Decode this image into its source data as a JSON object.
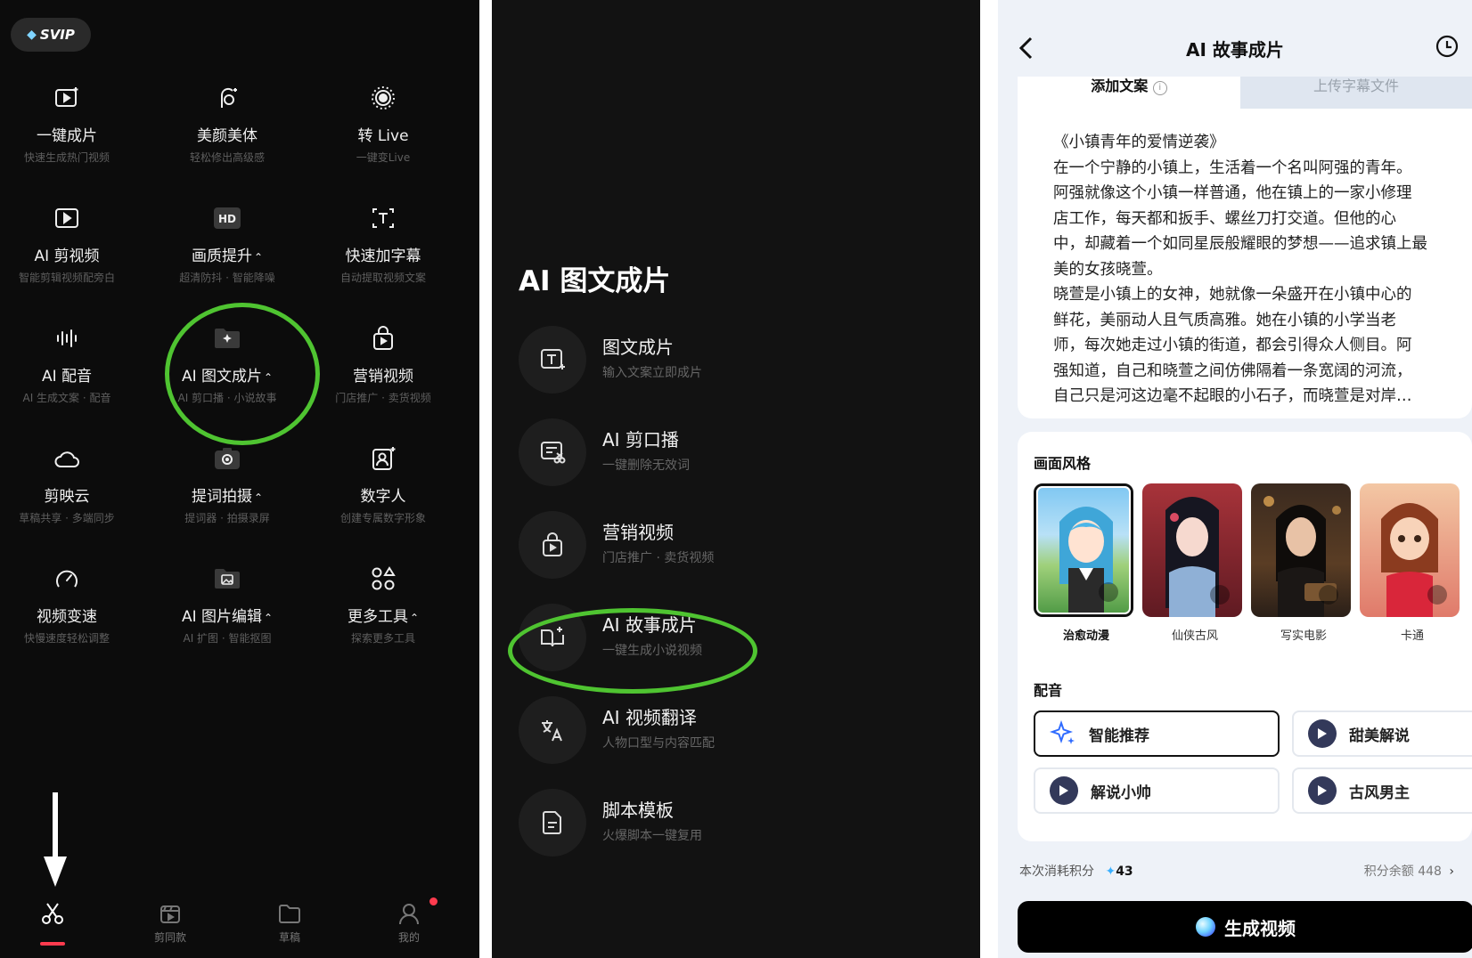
{
  "panel1": {
    "svip_label": "SVIP",
    "tools": [
      {
        "title": "一键成片",
        "sub": "快速生成热门视频",
        "icon": "play-sparkle-icon"
      },
      {
        "title": "美颜美体",
        "sub": "轻松修出高级感",
        "icon": "face-icon"
      },
      {
        "title": "转 Live",
        "sub": "一键变Live",
        "icon": "live-icon"
      },
      {
        "title": "AI 剪视频",
        "sub": "智能剪辑视频配旁白",
        "icon": "ai-video-icon"
      },
      {
        "title": "画质提升",
        "sub": "超清防抖 · 智能降噪",
        "icon": "hd-icon",
        "chevron": "⌃"
      },
      {
        "title": "快速加字幕",
        "sub": "自动提取视频文案",
        "icon": "subtitle-icon"
      },
      {
        "title": "AI 配音",
        "sub": "AI 生成文案 · 配音",
        "icon": "waveform-icon"
      },
      {
        "title": "AI 图文成片",
        "sub": "AI 剪口播 · 小说故事",
        "icon": "folder-sparkle-icon",
        "chevron": "⌃"
      },
      {
        "title": "营销视频",
        "sub": "门店推广 · 卖货视频",
        "icon": "shopping-bag-icon"
      },
      {
        "title": "剪映云",
        "sub": "草稿共享 · 多端同步",
        "icon": "cloud-icon"
      },
      {
        "title": "提词拍摄",
        "sub": "提词器 · 拍摄录屏",
        "icon": "camera-icon",
        "chevron": "⌃"
      },
      {
        "title": "数字人",
        "sub": "创建专属数字形象",
        "icon": "digital-human-icon"
      },
      {
        "title": "视频变速",
        "sub": "快慢速度轻松调整",
        "icon": "speed-icon"
      },
      {
        "title": "AI 图片编辑",
        "sub": "AI 扩图 · 智能抠图",
        "icon": "image-edit-icon",
        "chevron": "⌃"
      },
      {
        "title": "更多工具",
        "sub": "探索更多工具",
        "icon": "more-tools-icon",
        "chevron": "⌃"
      }
    ],
    "tabbar": [
      {
        "label": "",
        "icon": "scissors-icon"
      },
      {
        "label": "剪同款",
        "icon": "template-icon"
      },
      {
        "label": "草稿",
        "icon": "folder-icon"
      },
      {
        "label": "我的",
        "icon": "profile-icon"
      }
    ]
  },
  "panel2": {
    "heading": "AI 图文成片",
    "items": [
      {
        "title": "图文成片",
        "sub": "输入文案立即成片",
        "icon": "text-to-video-icon"
      },
      {
        "title": "AI 剪口播",
        "sub": "一键删除无效词",
        "icon": "cut-speech-icon"
      },
      {
        "title": "营销视频",
        "sub": "门店推广 · 卖货视频",
        "icon": "shopping-bag-icon"
      },
      {
        "title": "AI 故事成片",
        "sub": "一键生成小说视频",
        "icon": "book-sparkle-icon"
      },
      {
        "title": "AI 视频翻译",
        "sub": "人物口型与内容匹配",
        "icon": "translate-icon"
      },
      {
        "title": "脚本模板",
        "sub": "火爆脚本一键复用",
        "icon": "script-icon"
      }
    ]
  },
  "panel3": {
    "title": "AI 故事成片",
    "tab_add": "添加文案",
    "tab_upload": "上传字幕文件",
    "story_lines": [
      "《小镇青年的爱情逆袭》",
      "在一个宁静的小镇上，生活着一个名叫阿强的青年。",
      "阿强就像这个小镇一样普通，他在镇上的一家小修理",
      "店工作，每天都和扳手、螺丝刀打交道。但他的心",
      "中，却藏着一个如同星辰般耀眼的梦想——追求镇上最",
      "美的女孩晓萱。",
      "晓萱是小镇上的女神，她就像一朵盛开在小镇中心的",
      "鲜花，美丽动人且气质高雅。她在小镇的小学当老",
      "师，每次她走过小镇的街道，都会引得众人侧目。阿",
      "强知道，自己和晓萱之间仿佛隔着一条宽阔的河流，",
      "自己只是河这边毫不起眼的小石子，而晓萱是对岸…"
    ],
    "style_heading": "画面风格",
    "styles": [
      "治愈动漫",
      "仙侠古风",
      "写实电影",
      "卡通"
    ],
    "voice_heading": "配音",
    "voices": [
      "智能推荐",
      "甜美解说",
      "解说小帅",
      "古风男主"
    ],
    "cost_label": "本次消耗积分",
    "cost_value": "43",
    "balance": "积分余额 448",
    "generate": "生成视频"
  }
}
